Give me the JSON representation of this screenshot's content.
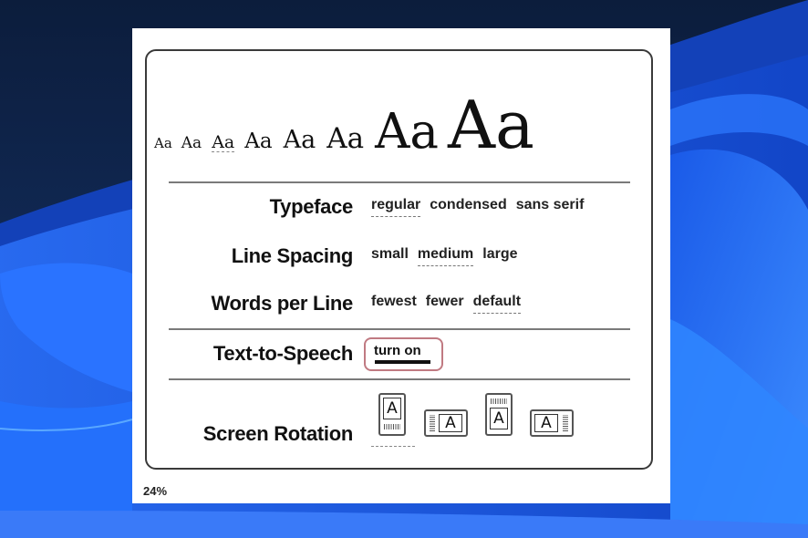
{
  "screen": {
    "font_sizes": {
      "samples": [
        "Aa",
        "Aa",
        "Aa",
        "Aa",
        "Aa",
        "Aa",
        "Aa",
        "Aa"
      ],
      "selected_index": 2
    },
    "settings": [
      {
        "label": "Typeface",
        "options": [
          "regular",
          "condensed",
          "sans serif"
        ],
        "selected": "regular"
      },
      {
        "label": "Line Spacing",
        "options": [
          "small",
          "medium",
          "large"
        ],
        "selected": "medium"
      },
      {
        "label": "Words per Line",
        "options": [
          "fewest",
          "fewer",
          "default"
        ],
        "selected": "default"
      }
    ],
    "text_to_speech": {
      "label": "Text-to-Speech",
      "button": "turn on"
    },
    "screen_rotation": {
      "label": "Screen Rotation",
      "icon_glyph": "A",
      "options": [
        "portrait",
        "landscape-left",
        "portrait-upside-down",
        "landscape-right"
      ],
      "selected": "portrait"
    },
    "progress_percent_label": "24%"
  },
  "colors": {
    "highlight_border": "#c07a82",
    "wallpaper_dark": "#0e2246",
    "wallpaper_blue": "#1f6cf0"
  }
}
